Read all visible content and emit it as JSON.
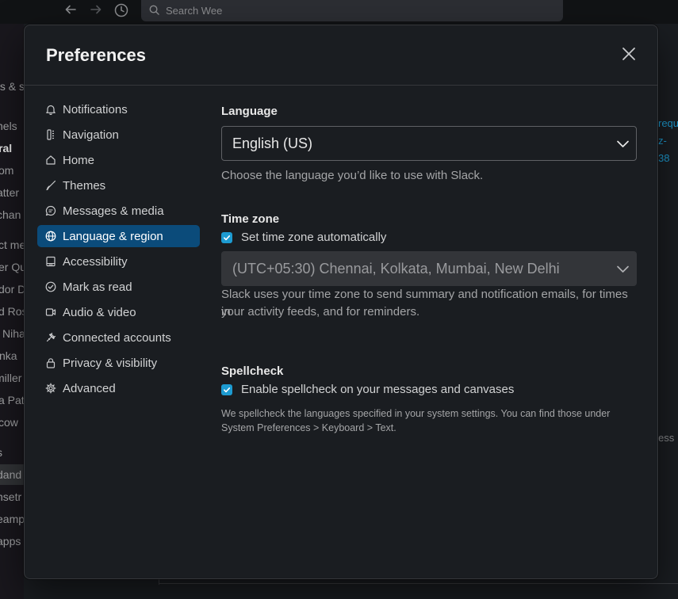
{
  "topbar": {
    "search_placeholder": "Search Wee"
  },
  "bg_sidebar": {
    "items": [
      "ts & s",
      "nels",
      "ral",
      "om",
      "atter",
      "chan",
      "ct me",
      "er Qu",
      "dor D",
      "d Ros",
      "Niha",
      "nka",
      "miller",
      "a Pat",
      "cow",
      "s",
      "dand",
      "nsetr",
      "eamp",
      "apps"
    ]
  },
  "bg_right": {
    "lines": [
      "requ",
      "z-",
      "38",
      "ess"
    ]
  },
  "modal": {
    "title": "Preferences",
    "menu": [
      {
        "label": "Notifications",
        "icon": "bell-icon"
      },
      {
        "label": "Navigation",
        "icon": "navigation-icon"
      },
      {
        "label": "Home",
        "icon": "home-icon"
      },
      {
        "label": "Themes",
        "icon": "brush-icon"
      },
      {
        "label": "Messages & media",
        "icon": "message-icon"
      },
      {
        "label": "Language & region",
        "icon": "globe-icon",
        "active": true
      },
      {
        "label": "Accessibility",
        "icon": "keyboard-icon"
      },
      {
        "label": "Mark as read",
        "icon": "check-circle-icon"
      },
      {
        "label": "Audio & video",
        "icon": "video-icon"
      },
      {
        "label": "Connected accounts",
        "icon": "plug-icon"
      },
      {
        "label": "Privacy & visibility",
        "icon": "lock-icon"
      },
      {
        "label": "Advanced",
        "icon": "gear-icon"
      }
    ],
    "language": {
      "title": "Language",
      "value": "English (US)",
      "help": "Choose the language you’d like to use with Slack."
    },
    "timezone": {
      "title": "Time zone",
      "auto_label": "Set time zone automatically",
      "auto_checked": true,
      "value": "(UTC+05:30) Chennai, Kolkata, Mumbai, New Delhi",
      "help_line1": "Slack uses your time zone to send summary and notification emails, for times in",
      "help_line2": "your activity feeds, and for reminders."
    },
    "spellcheck": {
      "title": "Spellcheck",
      "enable_label": "Enable spellcheck on your messages and canvases",
      "enable_checked": true,
      "help_line1": "We spellcheck the languages specified in your system settings. You can find those under",
      "help_line2": "System Preferences > Keyboard > Text."
    }
  },
  "colors": {
    "accent": "#1d9bd1",
    "active_menu": "#0b4b7a",
    "modal_bg": "#1a1d21"
  }
}
